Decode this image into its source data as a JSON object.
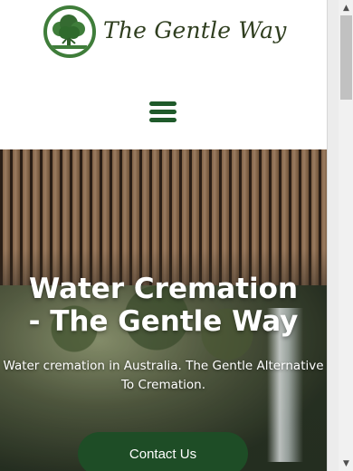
{
  "header": {
    "logo_text": "The Gentle Way",
    "menu_icon": "hamburger-menu-icon"
  },
  "hero": {
    "title_line1": "Water Cremation",
    "title_line2": "- The Gentle Way",
    "subtitle": "Water cremation in Australia. The Gentle Alternative To Cremation.",
    "cta_label": "Contact Us"
  },
  "colors": {
    "brand_green": "#1e4d26",
    "logo_green": "#3f7d3a",
    "menu_green": "#1f5a2a",
    "text_white": "#ffffff"
  },
  "scrollbar": {
    "up_icon": "scroll-up-arrow-icon",
    "down_icon": "scroll-down-arrow-icon"
  }
}
